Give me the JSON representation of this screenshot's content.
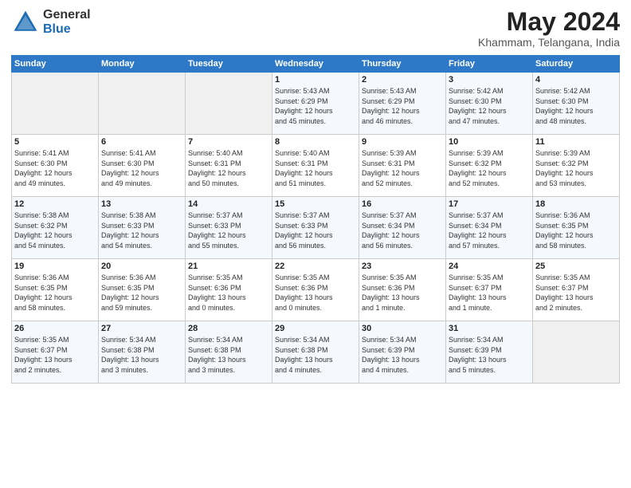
{
  "logo": {
    "general": "General",
    "blue": "Blue"
  },
  "header": {
    "month": "May 2024",
    "location": "Khammam, Telangana, India"
  },
  "weekdays": [
    "Sunday",
    "Monday",
    "Tuesday",
    "Wednesday",
    "Thursday",
    "Friday",
    "Saturday"
  ],
  "weeks": [
    [
      {
        "day": "",
        "info": ""
      },
      {
        "day": "",
        "info": ""
      },
      {
        "day": "",
        "info": ""
      },
      {
        "day": "1",
        "info": "Sunrise: 5:43 AM\nSunset: 6:29 PM\nDaylight: 12 hours\nand 45 minutes."
      },
      {
        "day": "2",
        "info": "Sunrise: 5:43 AM\nSunset: 6:29 PM\nDaylight: 12 hours\nand 46 minutes."
      },
      {
        "day": "3",
        "info": "Sunrise: 5:42 AM\nSunset: 6:30 PM\nDaylight: 12 hours\nand 47 minutes."
      },
      {
        "day": "4",
        "info": "Sunrise: 5:42 AM\nSunset: 6:30 PM\nDaylight: 12 hours\nand 48 minutes."
      }
    ],
    [
      {
        "day": "5",
        "info": "Sunrise: 5:41 AM\nSunset: 6:30 PM\nDaylight: 12 hours\nand 49 minutes."
      },
      {
        "day": "6",
        "info": "Sunrise: 5:41 AM\nSunset: 6:30 PM\nDaylight: 12 hours\nand 49 minutes."
      },
      {
        "day": "7",
        "info": "Sunrise: 5:40 AM\nSunset: 6:31 PM\nDaylight: 12 hours\nand 50 minutes."
      },
      {
        "day": "8",
        "info": "Sunrise: 5:40 AM\nSunset: 6:31 PM\nDaylight: 12 hours\nand 51 minutes."
      },
      {
        "day": "9",
        "info": "Sunrise: 5:39 AM\nSunset: 6:31 PM\nDaylight: 12 hours\nand 52 minutes."
      },
      {
        "day": "10",
        "info": "Sunrise: 5:39 AM\nSunset: 6:32 PM\nDaylight: 12 hours\nand 52 minutes."
      },
      {
        "day": "11",
        "info": "Sunrise: 5:39 AM\nSunset: 6:32 PM\nDaylight: 12 hours\nand 53 minutes."
      }
    ],
    [
      {
        "day": "12",
        "info": "Sunrise: 5:38 AM\nSunset: 6:32 PM\nDaylight: 12 hours\nand 54 minutes."
      },
      {
        "day": "13",
        "info": "Sunrise: 5:38 AM\nSunset: 6:33 PM\nDaylight: 12 hours\nand 54 minutes."
      },
      {
        "day": "14",
        "info": "Sunrise: 5:37 AM\nSunset: 6:33 PM\nDaylight: 12 hours\nand 55 minutes."
      },
      {
        "day": "15",
        "info": "Sunrise: 5:37 AM\nSunset: 6:33 PM\nDaylight: 12 hours\nand 56 minutes."
      },
      {
        "day": "16",
        "info": "Sunrise: 5:37 AM\nSunset: 6:34 PM\nDaylight: 12 hours\nand 56 minutes."
      },
      {
        "day": "17",
        "info": "Sunrise: 5:37 AM\nSunset: 6:34 PM\nDaylight: 12 hours\nand 57 minutes."
      },
      {
        "day": "18",
        "info": "Sunrise: 5:36 AM\nSunset: 6:35 PM\nDaylight: 12 hours\nand 58 minutes."
      }
    ],
    [
      {
        "day": "19",
        "info": "Sunrise: 5:36 AM\nSunset: 6:35 PM\nDaylight: 12 hours\nand 58 minutes."
      },
      {
        "day": "20",
        "info": "Sunrise: 5:36 AM\nSunset: 6:35 PM\nDaylight: 12 hours\nand 59 minutes."
      },
      {
        "day": "21",
        "info": "Sunrise: 5:35 AM\nSunset: 6:36 PM\nDaylight: 13 hours\nand 0 minutes."
      },
      {
        "day": "22",
        "info": "Sunrise: 5:35 AM\nSunset: 6:36 PM\nDaylight: 13 hours\nand 0 minutes."
      },
      {
        "day": "23",
        "info": "Sunrise: 5:35 AM\nSunset: 6:36 PM\nDaylight: 13 hours\nand 1 minute."
      },
      {
        "day": "24",
        "info": "Sunrise: 5:35 AM\nSunset: 6:37 PM\nDaylight: 13 hours\nand 1 minute."
      },
      {
        "day": "25",
        "info": "Sunrise: 5:35 AM\nSunset: 6:37 PM\nDaylight: 13 hours\nand 2 minutes."
      }
    ],
    [
      {
        "day": "26",
        "info": "Sunrise: 5:35 AM\nSunset: 6:37 PM\nDaylight: 13 hours\nand 2 minutes."
      },
      {
        "day": "27",
        "info": "Sunrise: 5:34 AM\nSunset: 6:38 PM\nDaylight: 13 hours\nand 3 minutes."
      },
      {
        "day": "28",
        "info": "Sunrise: 5:34 AM\nSunset: 6:38 PM\nDaylight: 13 hours\nand 3 minutes."
      },
      {
        "day": "29",
        "info": "Sunrise: 5:34 AM\nSunset: 6:38 PM\nDaylight: 13 hours\nand 4 minutes."
      },
      {
        "day": "30",
        "info": "Sunrise: 5:34 AM\nSunset: 6:39 PM\nDaylight: 13 hours\nand 4 minutes."
      },
      {
        "day": "31",
        "info": "Sunrise: 5:34 AM\nSunset: 6:39 PM\nDaylight: 13 hours\nand 5 minutes."
      },
      {
        "day": "",
        "info": ""
      }
    ]
  ]
}
